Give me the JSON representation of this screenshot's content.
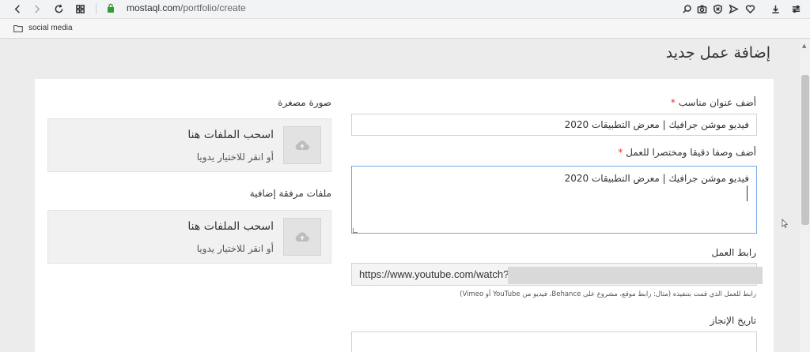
{
  "browser": {
    "url_host": "mostaql.com",
    "url_path": "/portfolio/create",
    "bookmark": "social media"
  },
  "page": {
    "title": "إضافة عمل جديد"
  },
  "form": {
    "title_label": "أضف عنوان مناسب",
    "title_value": "فيديو موشن جرافيك | معرض التطبيقات 2020",
    "desc_label": "أضف وصفا دقيقا ومختصرا للعمل",
    "desc_value": "فيديو موشن جرافيك | معرض التطبيقات 2020",
    "link_label": "رابط العمل",
    "link_value": "https://www.youtube.com/watch?",
    "link_help": "رابط للعمل الذي قمت بتنفيذه (مثال: رابط موقع، مشروع على Behance، فيديو من YouTube أو Vimeo)",
    "date_label": "تاريخ الإنجاز",
    "required_mark": "*"
  },
  "uploads": {
    "thumb_label": "صورة مصغرة",
    "attach_label": "ملفات مرفقة إضافية",
    "drop_title": "اسحب الملفات هنا",
    "drop_sub": "أو انقر للاختيار يدويا"
  }
}
